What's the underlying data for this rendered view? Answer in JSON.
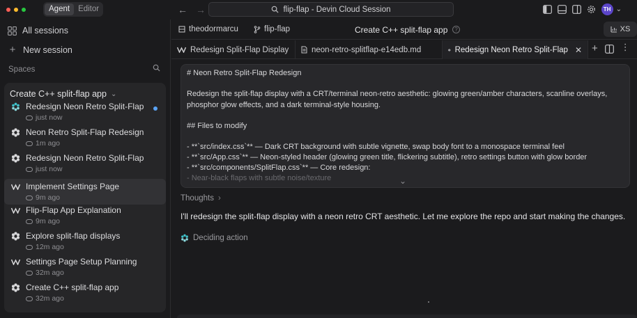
{
  "window": {
    "modes": [
      "Agent",
      "Editor"
    ],
    "active_mode": "Agent",
    "search_text": "flip-flap - Devin Cloud Session",
    "avatar_initials": "TH"
  },
  "sidebar": {
    "all_sessions_label": "All sessions",
    "new_session_label": "New session",
    "spaces_label": "Spaces",
    "space": {
      "title": "Create C++ split-flap app",
      "sessions": [
        {
          "title": "Redesign Neon Retro Split-Flap",
          "time": "just now",
          "icon": "devin-logo-icon",
          "unread": true
        },
        {
          "title": "Neon Retro Split-Flap Redesign",
          "time": "1m ago",
          "icon": "devin-flower-icon",
          "unread": false
        },
        {
          "title": "Redesign Neon Retro Split-Flap",
          "time": "just now",
          "icon": "devin-flower-icon",
          "unread": false
        },
        {
          "title": "Implement Settings Page",
          "time": "9m ago",
          "icon": "windsurf-icon",
          "unread": false
        },
        {
          "title": "Flip-Flap App Explanation",
          "time": "9m ago",
          "icon": "windsurf-icon",
          "unread": false
        },
        {
          "title": "Explore split-flap displays",
          "time": "12m ago",
          "icon": "devin-flower-icon",
          "unread": false
        },
        {
          "title": "Settings Page Setup Planning",
          "time": "32m ago",
          "icon": "windsurf-icon",
          "unread": false
        },
        {
          "title": "Create C++ split-flap app",
          "time": "32m ago",
          "icon": "devin-flower-icon",
          "unread": false
        }
      ]
    }
  },
  "header": {
    "owner": "theodormarcu",
    "repo": "flip-flap",
    "title": "Create C++ split-flap app",
    "help": "?",
    "size_label": "XS"
  },
  "tabs": [
    {
      "label": "Redesign Split-Flap Display",
      "icon": "windsurf-icon",
      "active": false
    },
    {
      "label": "neon-retro-splitflap-e14edb.md",
      "icon": "file-icon",
      "active": false
    },
    {
      "label": "Redesign Neon Retro Split-Flap",
      "icon": "devin-flower-icon",
      "active": true
    }
  ],
  "plan": {
    "lines": [
      "# Neon Retro Split-Flap Redesign",
      "Redesign the split-flap display with a CRT/terminal neon-retro aesthetic: glowing green/amber characters, scanline overlays,",
      "phosphor glow effects, and a dark terminal-style housing.",
      "## Files to modify",
      "- **`src/index.css`** — Dark CRT background with subtle vignette, swap body font to a monospace terminal feel",
      "- **`src/App.css`** — Neon-styled header (glowing green title, flickering subtitle), retro settings button with glow border",
      "- **`src/components/SplitFlap.css`** — Core redesign:",
      "  - Near-black flaps with subtle noise/texture"
    ]
  },
  "thoughts_label": "Thoughts",
  "reply": "I'll redesign the split-flap display with a neon retro CRT aesthetic. Let me explore the repo and start making the changes.",
  "status": "Deciding action",
  "colors": {
    "accent_purple": "#5b45c9",
    "unread_dot": "#5aa3f5",
    "devin_teal": "#3fc1c9"
  }
}
